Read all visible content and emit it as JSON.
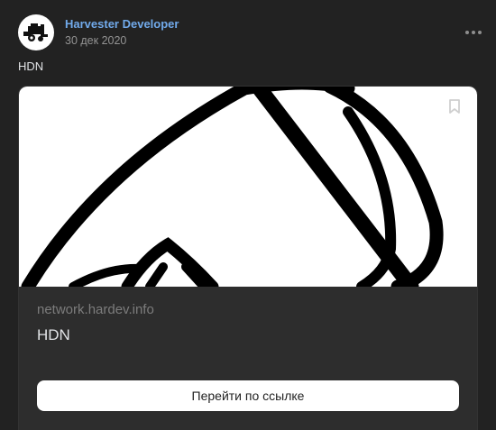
{
  "post": {
    "author": "Harvester Developer",
    "date": "30 дек 2020",
    "text": "HDN"
  },
  "link_card": {
    "domain": "network.hardev.info",
    "title": "HDN",
    "button_label": "Перейти по ссылке"
  },
  "icons": {
    "avatar": "harvester-logo-icon",
    "more": "more-horizontal-icon",
    "bookmark": "bookmark-icon"
  },
  "colors": {
    "background": "#222222",
    "author_link": "#71aaeb",
    "card_background": "#2d2d2d",
    "button_background": "#ffffff"
  }
}
